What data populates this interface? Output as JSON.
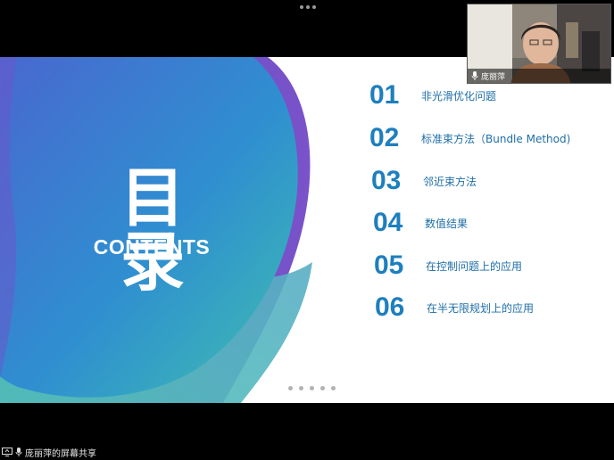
{
  "slide": {
    "title": "目录",
    "subtitle": "CONTENTS",
    "items": [
      {
        "num": "01",
        "label": "非光滑优化问题"
      },
      {
        "num": "02",
        "label": "标准束方法（Bundle Method)"
      },
      {
        "num": "03",
        "label": "邻近束方法"
      },
      {
        "num": "04",
        "label": "数值结果"
      },
      {
        "num": "05",
        "label": "在控制问题上的应用"
      },
      {
        "num": "06",
        "label": "在半无限规划上的应用"
      }
    ],
    "page_dots": 5
  },
  "participant": {
    "name": "庞丽萍",
    "mic_icon": "microphone-icon"
  },
  "share_status": {
    "text": "庞丽萍的屏幕共享",
    "screen_icon": "screen-share-icon",
    "mic_icon": "microphone-icon"
  },
  "colors": {
    "accent": "#1d7fbe",
    "blob_start": "#3b5fc6",
    "blob_end": "#3fb4b8"
  }
}
